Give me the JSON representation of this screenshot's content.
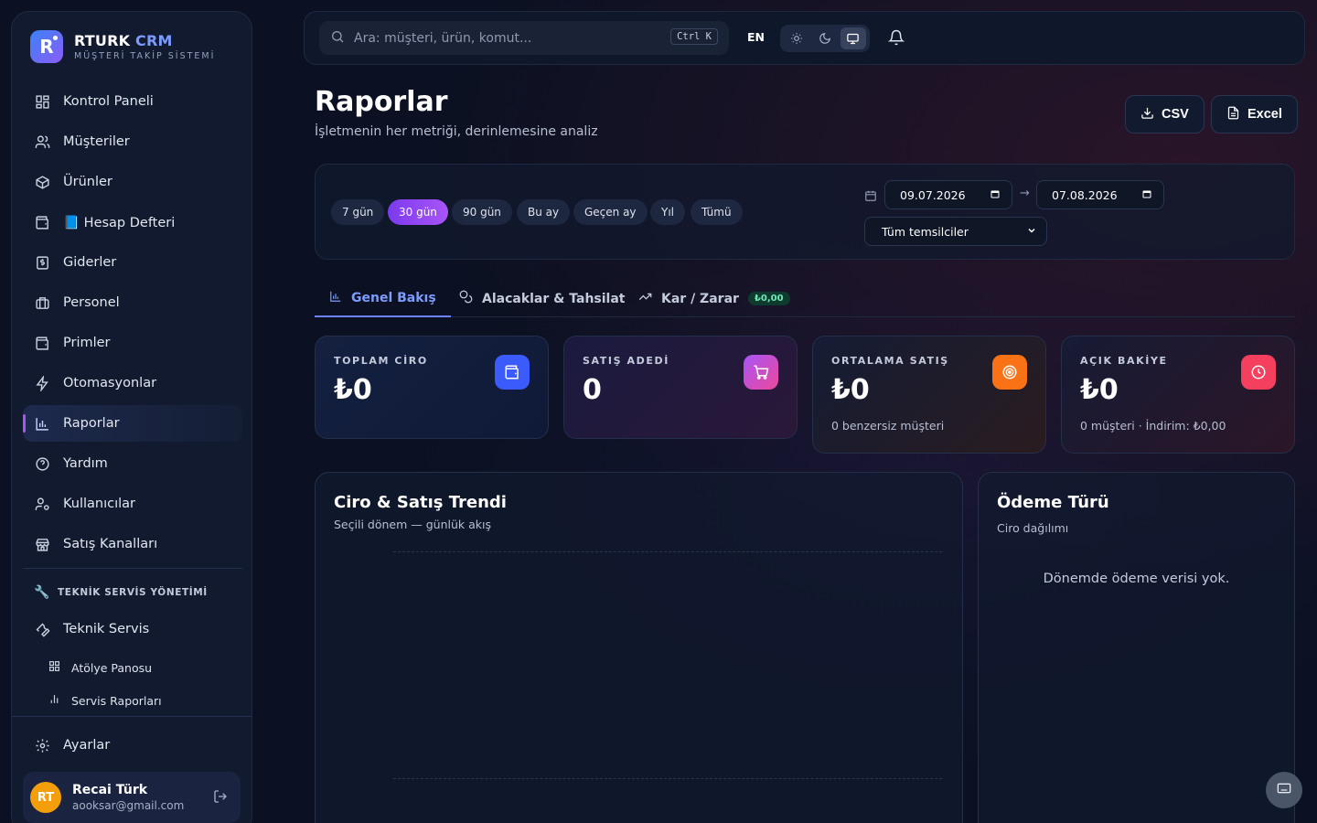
{
  "brand": {
    "name": "RTURK",
    "name_accent": "CRM",
    "subtitle": "MÜŞTERİ TAKİP SİSTEMİ",
    "logo_letter": "R"
  },
  "sidebar": {
    "items": [
      {
        "label": "Kontrol Paneli",
        "icon": "dashboard-icon"
      },
      {
        "label": "Müşteriler",
        "icon": "users-icon"
      },
      {
        "label": "Ürünler",
        "icon": "box-icon"
      },
      {
        "label": "📘 Hesap Defteri",
        "icon": "wallet-icon"
      },
      {
        "label": "Giderler",
        "icon": "receipt-icon"
      },
      {
        "label": "Personel",
        "icon": "briefcase-icon"
      },
      {
        "label": "Primler",
        "icon": "wallet-icon"
      },
      {
        "label": "Otomasyonlar",
        "icon": "bolt-icon"
      },
      {
        "label": "Raporlar",
        "icon": "bar-chart-icon",
        "active": true
      },
      {
        "label": "Yardım",
        "icon": "help-icon"
      },
      {
        "label": "Kullanıcılar",
        "icon": "user-cog-icon"
      },
      {
        "label": "Satış Kanalları",
        "icon": "store-icon"
      }
    ],
    "service_section": {
      "label": "TEKNİK SERVİS YÖNETİMİ",
      "main": "Teknik Servis",
      "subs": [
        "Atölye Panosu",
        "Servis Raporları"
      ]
    },
    "settings": "Ayarlar",
    "user": {
      "initials": "RT",
      "name": "Recai Türk",
      "email": "aooksar@gmail.com"
    }
  },
  "topbar": {
    "search_placeholder": "Ara: müşteri, ürün, komut...",
    "shortcut": "Ctrl K",
    "lang": "EN"
  },
  "header": {
    "title": "Raporlar",
    "subtitle": "İşletmenin her metriği, derinlemesine analiz",
    "csv": "CSV",
    "excel": "Excel"
  },
  "filters": {
    "chips": [
      "7 gün",
      "30 gün",
      "90 gün",
      "Bu ay",
      "Geçen ay",
      "Yıl",
      "Tümü"
    ],
    "active_chip": "30 gün",
    "date_from": "09.07.2026",
    "date_to": "07.08.2026",
    "arrow": "→",
    "rep_select": "Tüm temsilciler"
  },
  "tabs": [
    {
      "label": "Genel Bakış",
      "active": true
    },
    {
      "label": "Alacaklar & Tahsilat"
    },
    {
      "label": "Kar / Zarar",
      "badge": "₺0,00"
    }
  ],
  "kpis": [
    {
      "label": "TOPLAM CİRO",
      "value": "₺0",
      "sub": "",
      "color": "#3b5bfd"
    },
    {
      "label": "SATIŞ ADEDİ",
      "value": "0",
      "sub": "",
      "color": "#c026d3"
    },
    {
      "label": "ORTALAMA SATIŞ",
      "value": "₺0",
      "sub": "0 benzersiz müşteri",
      "color": "#f97316"
    },
    {
      "label": "AÇIK BAKİYE",
      "value": "₺0",
      "sub": "0 müşteri · İndirim: ₺0,00",
      "color": "#f43f5e"
    }
  ],
  "trend_panel": {
    "title": "Ciro & Satış Trendi",
    "subtitle": "Seçili dönem — günlük akış"
  },
  "payment_panel": {
    "title": "Ödeme Türü",
    "subtitle": "Ciro dağılımı",
    "empty": "Dönemde ödeme verisi yok."
  }
}
